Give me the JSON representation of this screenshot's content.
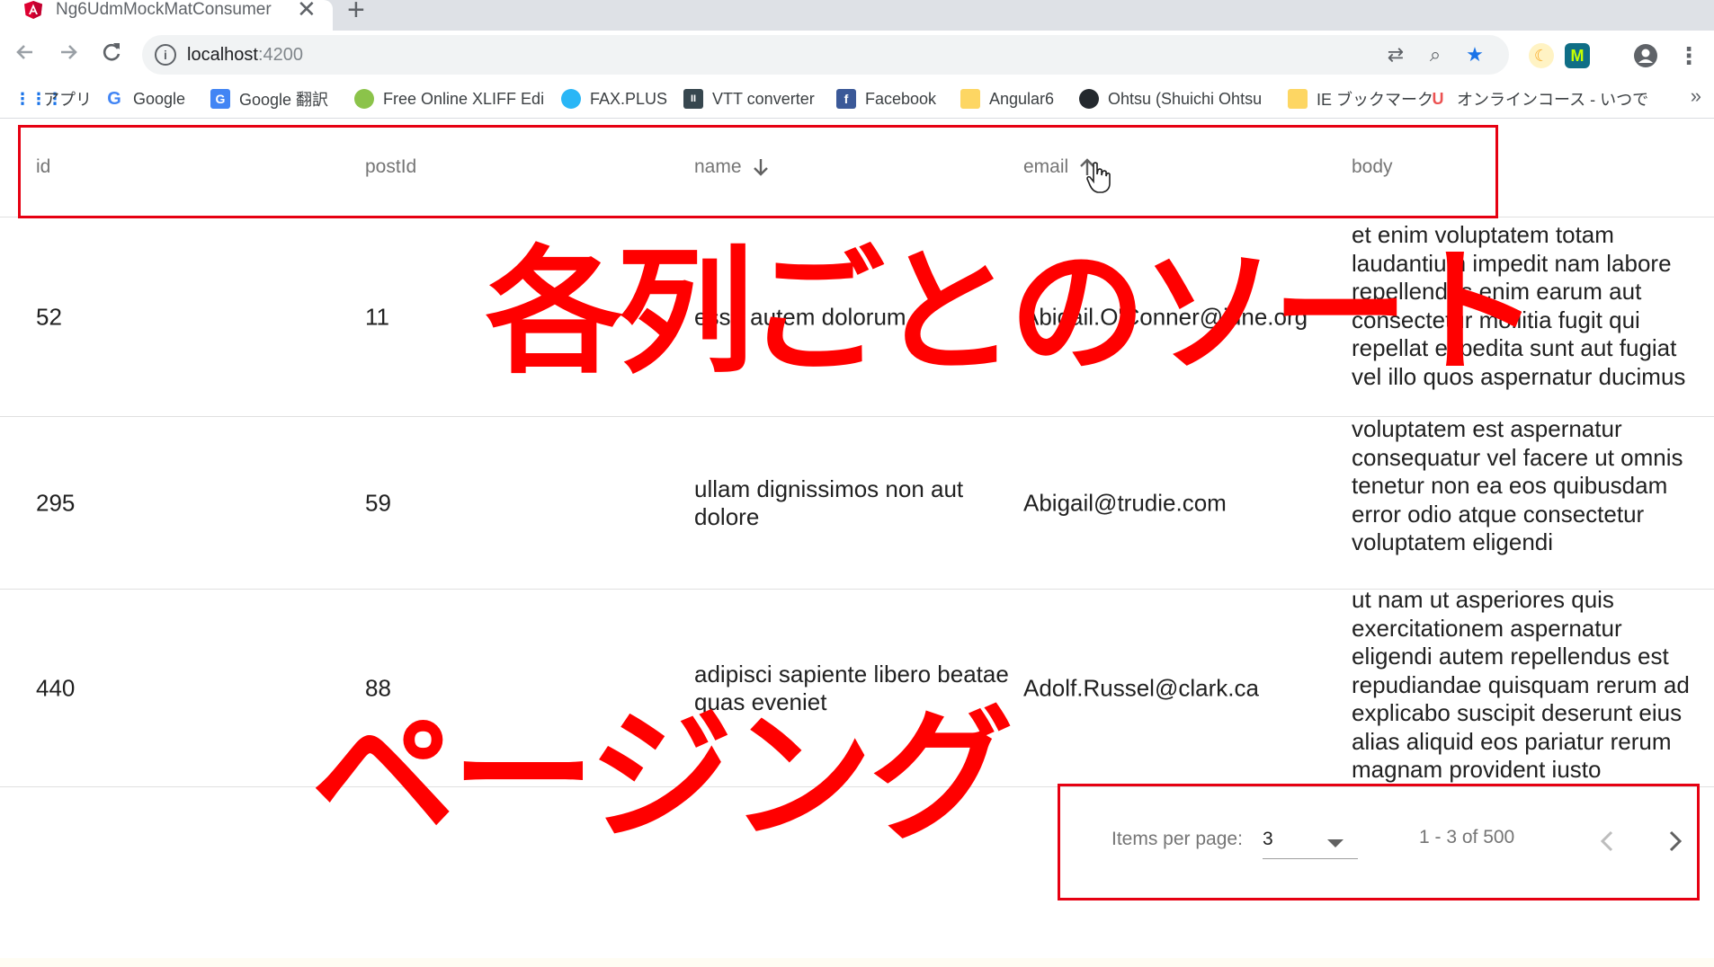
{
  "browser": {
    "tab_title": "Ng6UdmMockMatConsumer",
    "close_glyph": "✕",
    "newtab_glyph": "+",
    "url_host": "localhost",
    "url_port": ":4200",
    "bookmarks": [
      {
        "label": "アプリ",
        "icon": "apps-icon",
        "color": "#1a73e8"
      },
      {
        "label": "Google",
        "icon": "google-icon",
        "color": "#4285f4"
      },
      {
        "label": "Google 翻訳",
        "icon": "translate-icon",
        "color": "#4285f4"
      },
      {
        "label": "Free Online XLIFF Edi",
        "icon": "xliff-icon",
        "color": "#8bc34a"
      },
      {
        "label": "FAX.PLUS",
        "icon": "fax-icon",
        "color": "#29b6f6"
      },
      {
        "label": "VTT converter",
        "icon": "vtt-icon",
        "color": "#37474f"
      },
      {
        "label": "Facebook",
        "icon": "facebook-icon",
        "color": "#3b5998"
      },
      {
        "label": "Angular6",
        "icon": "folder-icon",
        "color": "#fdd663"
      },
      {
        "label": "Ohtsu (Shuichi Ohtsu",
        "icon": "github-icon",
        "color": "#24292e"
      },
      {
        "label": "IE ブックマーク",
        "icon": "folder-icon",
        "color": "#fdd663"
      },
      {
        "label": "オンラインコース - いつで",
        "icon": "udemy-icon",
        "color": "#ec5252"
      }
    ],
    "bookmarks_more": "»"
  },
  "table": {
    "columns": [
      {
        "label": "id",
        "sort": ""
      },
      {
        "label": "postId",
        "sort": ""
      },
      {
        "label": "name",
        "sort": "desc"
      },
      {
        "label": "email",
        "sort": "asc"
      },
      {
        "label": "body",
        "sort": ""
      }
    ],
    "rows": [
      {
        "id": "52",
        "postId": "11",
        "name": "esse autem dolorum",
        "email": "Abigail.O'Conner@june.org",
        "body": "et enim voluptatem totam laudantium impedit nam labore repellendus enim earum aut consectetur mollitia fugit qui repellat expedita sunt aut fugiat vel illo quos aspernatur ducimus"
      },
      {
        "id": "295",
        "postId": "59",
        "name": "ullam dignissimos non aut dolore",
        "email": "Abigail@trudie.com",
        "body": "voluptatem est aspernatur consequatur vel facere ut omnis tenetur non ea eos quibusdam error odio atque consectetur voluptatem eligendi"
      },
      {
        "id": "440",
        "postId": "88",
        "name": "adipisci sapiente libero beatae quas eveniet",
        "email": "Adolf.Russel@clark.ca",
        "body": "ut nam ut asperiores quis exercitationem aspernatur eligendi autem repellendus est repudiandae quisquam rerum ad explicabo suscipit deserunt eius alias aliquid eos pariatur rerum magnam provident iusto"
      }
    ]
  },
  "paginator": {
    "items_per_page_label": "Items per page:",
    "page_size": "3",
    "range_label": "1 - 3 of 500"
  },
  "annotations": {
    "sort_caption": "各列ごとのソート",
    "paging_caption": "ページング",
    "color": "#ff0000"
  }
}
